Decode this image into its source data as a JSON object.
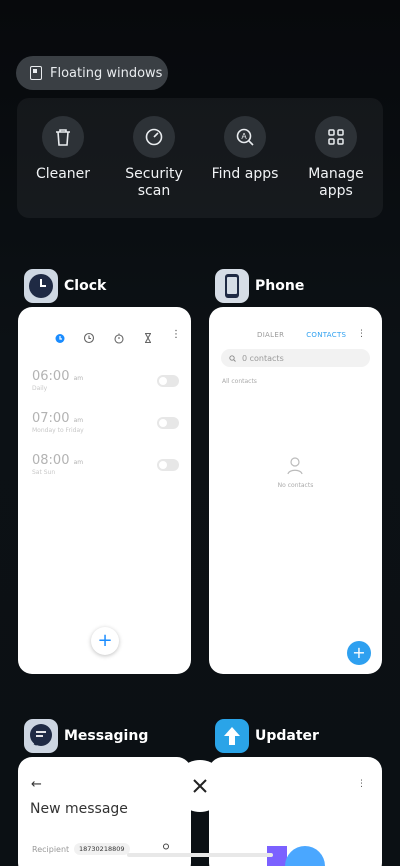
{
  "floating_windows": {
    "label": "Floating windows"
  },
  "quick_actions": [
    {
      "label": "Cleaner",
      "icon": "trash-icon"
    },
    {
      "label": "Security\nscan",
      "icon": "security-icon"
    },
    {
      "label": "Find apps",
      "icon": "find-apps-icon"
    },
    {
      "label": "Manage\napps",
      "icon": "grid-icon"
    }
  ],
  "apps": {
    "clock": {
      "name": "Clock",
      "alarms": [
        {
          "time": "06:00",
          "ampm": "am",
          "repeat": "Daily"
        },
        {
          "time": "07:00",
          "ampm": "am",
          "repeat": "Monday to Friday"
        },
        {
          "time": "08:00",
          "ampm": "am",
          "repeat": "Sat Sun"
        }
      ],
      "fab": "+"
    },
    "phone": {
      "name": "Phone",
      "tab_dialer": "DIALER",
      "tab_contacts": "CONTACTS",
      "more": "⋮",
      "search_placeholder": "0 contacts",
      "all_contacts": "All contacts",
      "empty": "No contacts",
      "fab": "+"
    },
    "messaging": {
      "name": "Messaging",
      "back": "←",
      "title": "New message",
      "recipient_label": "Recipient",
      "recipient_value": "18730218809"
    },
    "updater": {
      "name": "Updater",
      "more": "⋮"
    }
  },
  "colors": {
    "accent_blue": "#2ea0f0",
    "background": "#0b1014",
    "clock_accent": "#1a8cff"
  }
}
